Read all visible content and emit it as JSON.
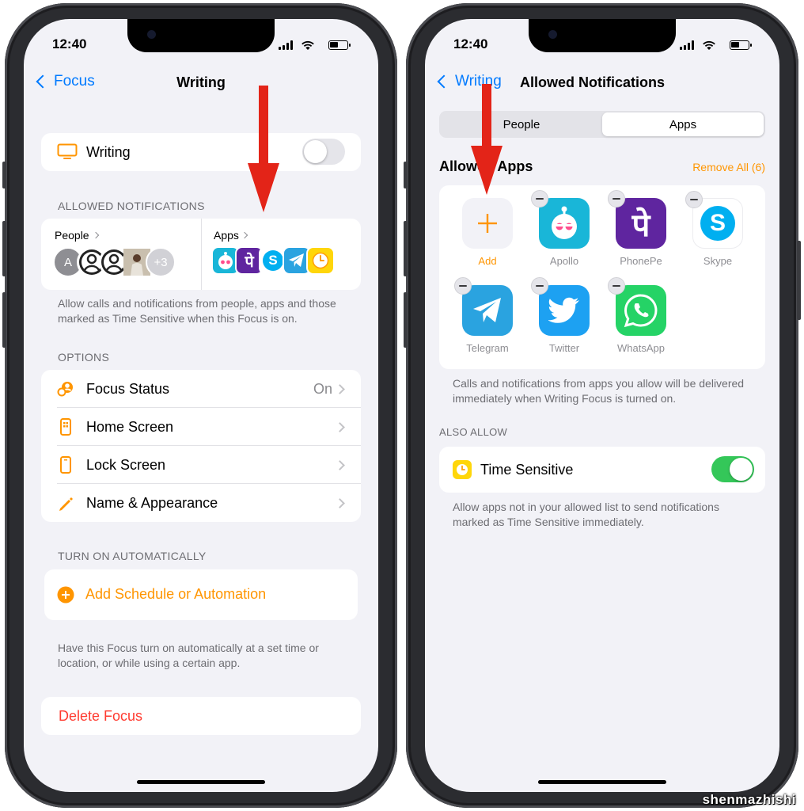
{
  "status": {
    "time": "12:40"
  },
  "left": {
    "nav": {
      "back": "Focus",
      "title": "Writing"
    },
    "focus_row": {
      "label": "Writing",
      "enabled": false
    },
    "allowed_header": "ALLOWED NOTIFICATIONS",
    "people": {
      "label": "People",
      "avatar_letter": "A",
      "extra": "+3"
    },
    "apps": {
      "label": "Apps",
      "icons": [
        "apollo-icon",
        "phonepe-icon",
        "skype-icon",
        "telegram-icon",
        "clock-icon"
      ]
    },
    "allowed_footer": "Allow calls and notifications from people, apps and those marked as Time Sensitive when this Focus is on.",
    "options_header": "OPTIONS",
    "options": [
      {
        "label": "Focus Status",
        "value": "On",
        "icon": "focus-status-icon"
      },
      {
        "label": "Home Screen",
        "value": "",
        "icon": "home-screen-icon"
      },
      {
        "label": "Lock Screen",
        "value": "",
        "icon": "lock-screen-icon"
      },
      {
        "label": "Name & Appearance",
        "value": "",
        "icon": "pencil-icon"
      }
    ],
    "auto_header": "TURN ON AUTOMATICALLY",
    "add_schedule": "Add Schedule or Automation",
    "auto_footer": "Have this Focus turn on automatically at a set time or location, or while using a certain app.",
    "delete": "Delete Focus"
  },
  "right": {
    "nav": {
      "back": "Writing",
      "title": "Allowed Notifications"
    },
    "segments": [
      "People",
      "Apps"
    ],
    "selected_segment": "Apps",
    "allowed_apps_title": "Allowed Apps",
    "remove_all": "Remove All (6)",
    "apps": [
      {
        "name": "Add",
        "icon": "add-icon"
      },
      {
        "name": "Apollo",
        "icon": "apollo-icon"
      },
      {
        "name": "PhonePe",
        "icon": "phonepe-icon"
      },
      {
        "name": "Skype",
        "icon": "skype-icon"
      },
      {
        "name": "Telegram",
        "icon": "telegram-icon"
      },
      {
        "name": "Twitter",
        "icon": "twitter-icon"
      },
      {
        "name": "WhatsApp",
        "icon": "whatsapp-icon"
      }
    ],
    "apps_footer": "Calls and notifications from apps you allow will be delivered immediately when Writing Focus is turned on.",
    "also_allow_header": "ALSO ALLOW",
    "time_sensitive": {
      "label": "Time Sensitive",
      "enabled": true
    },
    "time_sensitive_footer": "Allow apps not in your allowed list to send notifications marked as Time Sensitive immediately."
  },
  "watermark": "shenmazhishi",
  "colors": {
    "accent_blue": "#007aff",
    "orange": "#ff9500",
    "red": "#ff3b30",
    "green": "#34c759",
    "arrow": "#e32418",
    "phonepe": "#5f259f",
    "skype": "#00aff0",
    "telegram": "#2aa3e0",
    "twitter": "#1da1f2",
    "whatsapp": "#25d366"
  }
}
